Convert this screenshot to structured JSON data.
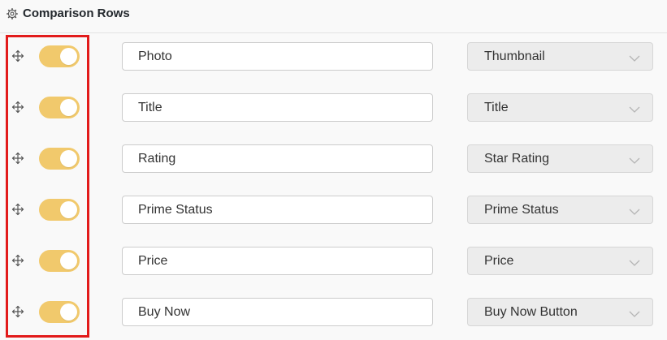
{
  "header": {
    "title": "Comparison Rows",
    "icon": "gear-icon"
  },
  "colors": {
    "toggle_on": "#f1c96c",
    "highlight_border": "#e21b1b",
    "select_bg": "#ececec"
  },
  "rows": [
    {
      "enabled": true,
      "label": "Photo",
      "field": "Thumbnail"
    },
    {
      "enabled": true,
      "label": "Title",
      "field": "Title"
    },
    {
      "enabled": true,
      "label": "Rating",
      "field": "Star Rating"
    },
    {
      "enabled": true,
      "label": "Prime Status",
      "field": "Prime Status"
    },
    {
      "enabled": true,
      "label": "Price",
      "field": "Price"
    },
    {
      "enabled": true,
      "label": "Buy Now",
      "field": "Buy Now Button"
    }
  ]
}
